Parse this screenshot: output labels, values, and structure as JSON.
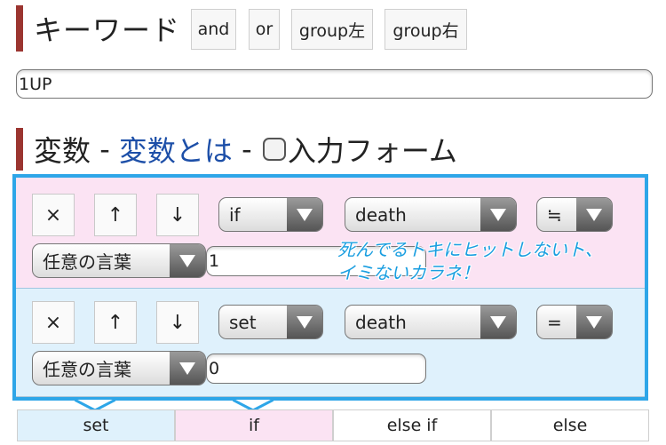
{
  "keyword": {
    "title": "キーワード",
    "buttons": [
      "and",
      "or",
      "group左",
      "group右"
    ],
    "input_value": "1UP"
  },
  "variables": {
    "title": "変数",
    "sep1": " - ",
    "link": "変数とは",
    "sep2": " - ",
    "form_label": "入力フォーム"
  },
  "blocks": [
    {
      "type": "if",
      "ctrl": [
        "×",
        "↑",
        "↓"
      ],
      "kind": "if",
      "variable": "death",
      "operator": "≒",
      "word_type": "任意の言葉",
      "value": "1",
      "note_line1": "死んでるトキにヒットしないト、",
      "note_line2": "イミないカラネ！"
    },
    {
      "type": "set",
      "ctrl": [
        "×",
        "↑",
        "↓"
      ],
      "kind": "set",
      "variable": "death",
      "operator": "=",
      "word_type": "任意の言葉",
      "value": "0"
    }
  ],
  "tabs": [
    "set",
    "if",
    "else if",
    "else"
  ],
  "colors": {
    "accent_bar": "#9b3530",
    "frame": "#2ea6e8",
    "if_bg": "#fbe3f3",
    "set_bg": "#dff1fc",
    "link": "#1d4fa8"
  }
}
